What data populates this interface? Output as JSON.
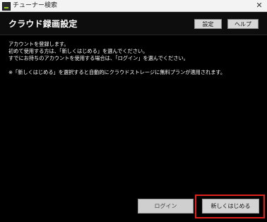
{
  "window": {
    "title": "チューナー検索",
    "close_label": "✕"
  },
  "header": {
    "title": "クラウド録画設定",
    "settings_label": "設定",
    "help_label": "ヘルプ"
  },
  "message": {
    "line1": "アカウントを登録します。",
    "line2": "初めて使用する方は、「新しくはじめる」を選んでください。",
    "line3": "すでにお持ちのアカウントを使用する場合は、「ログイン」を選んでください。",
    "note": "※「新しくはじめる」を選択すると自動的にクラウドストレージに無料プランが適用されます。"
  },
  "footer": {
    "login_label": "ログイン",
    "start_label": "新しくはじめる"
  },
  "colors": {
    "background": "#000000",
    "highlight": "#e0201c"
  }
}
